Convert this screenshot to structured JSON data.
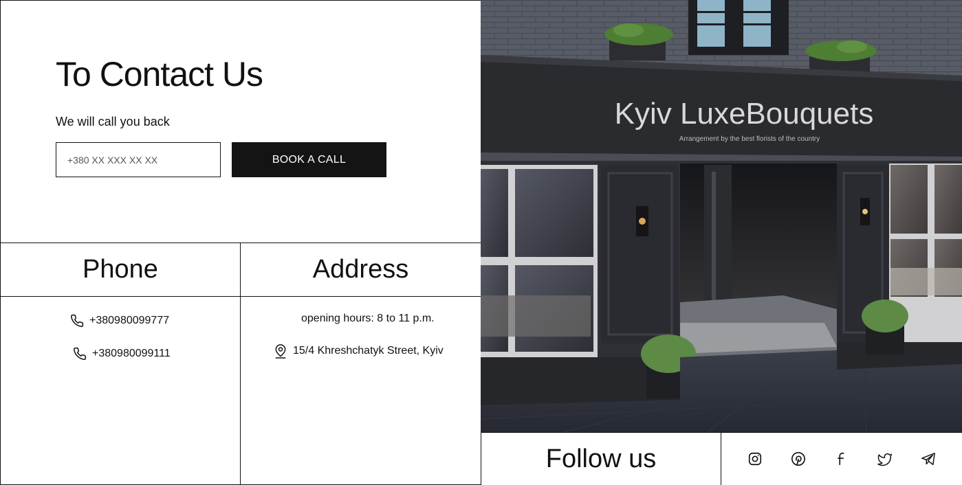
{
  "contact": {
    "title": "To Contact Us",
    "subtitle": "We will call you back",
    "phone_placeholder": "+380 XX XXX XX XX",
    "book_label": "BOOK A CALL"
  },
  "phone_section": {
    "heading": "Phone",
    "numbers": [
      "+380980099777",
      "+380980099111"
    ]
  },
  "address_section": {
    "heading": "Address",
    "hours": "opening hours: 8 to 11 p.m.",
    "address": "15/4 Khreshchatyk Street, Kyiv"
  },
  "storefront": {
    "sign_title": "Kyiv LuxeBouquets",
    "sign_tagline": "Arrangement by the best florists of the country"
  },
  "follow": {
    "heading": "Follow us",
    "icons": [
      "instagram-icon",
      "pinterest-icon",
      "facebook-icon",
      "twitter-icon",
      "telegram-icon"
    ]
  },
  "colors": {
    "primary": "#141414",
    "background": "#ffffff"
  }
}
